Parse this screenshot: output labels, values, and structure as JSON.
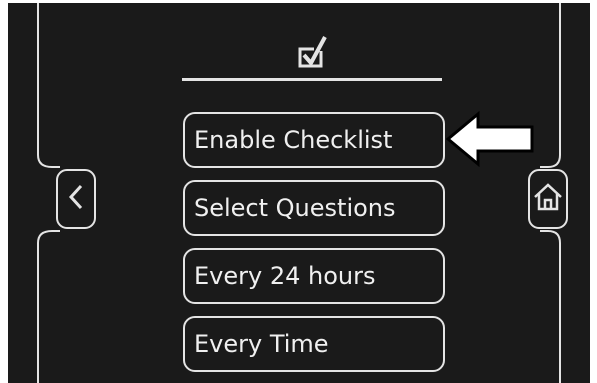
{
  "screen": {
    "header_icon": "checkbox-checked-icon",
    "nav": {
      "back_icon": "chevron-left-icon",
      "home_icon": "home-icon"
    },
    "menu": {
      "items": [
        {
          "label": "Enable Checklist",
          "highlighted": true
        },
        {
          "label": "Select Questions"
        },
        {
          "label": "Every 24 hours"
        },
        {
          "label": "Every Time"
        }
      ]
    },
    "annotation": {
      "icon": "arrow-left-pointer-icon",
      "target": "menu-item-0"
    }
  },
  "colors": {
    "background": "#1a1a1a",
    "foreground": "#e4e4e4",
    "page": "#ffffff"
  }
}
